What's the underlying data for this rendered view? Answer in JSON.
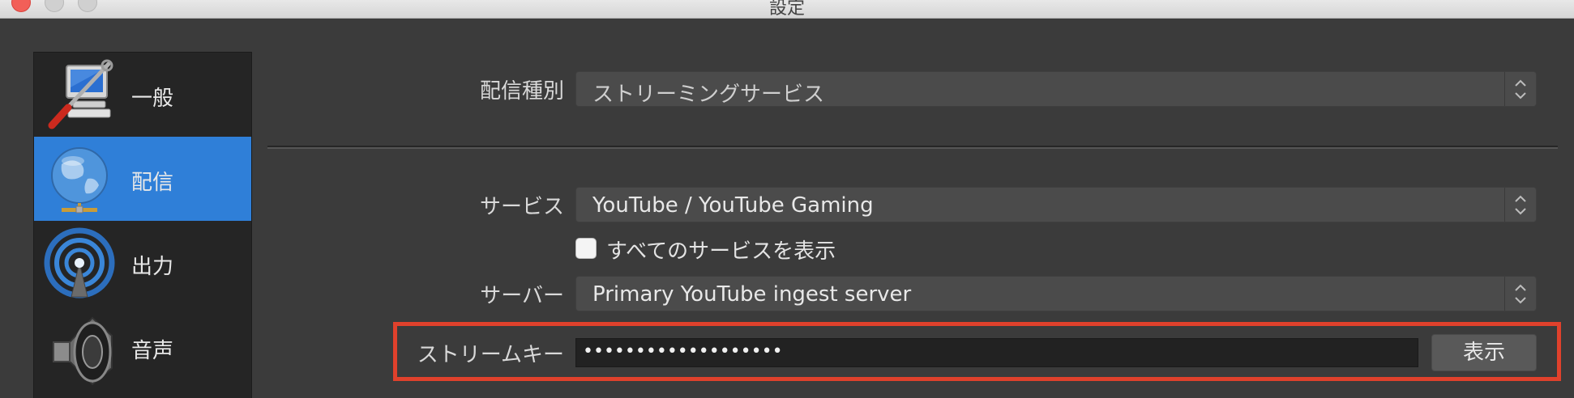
{
  "window": {
    "title": "設定"
  },
  "sidebar": {
    "items": [
      {
        "label": "一般",
        "icon": "tools-computer-icon",
        "active": false
      },
      {
        "label": "配信",
        "icon": "globe-network-icon",
        "active": true
      },
      {
        "label": "出力",
        "icon": "broadcast-antenna-icon",
        "active": false
      },
      {
        "label": "音声",
        "icon": "speaker-icon",
        "active": false
      }
    ]
  },
  "stream": {
    "type_label": "配信種別",
    "type_value": "ストリーミングサービス",
    "service_label": "サービス",
    "service_value": "YouTube / YouTube Gaming",
    "show_all_label": "すべてのサービスを表示",
    "show_all_checked": false,
    "server_label": "サーバー",
    "server_value": "Primary YouTube ingest server",
    "key_label": "ストリームキー",
    "key_value": "•••••••••••••••••••",
    "show_button_label": "表示"
  },
  "colors": {
    "accent": "#2f7fd8",
    "highlight": "#e0412c",
    "background": "#3b3b3b"
  }
}
